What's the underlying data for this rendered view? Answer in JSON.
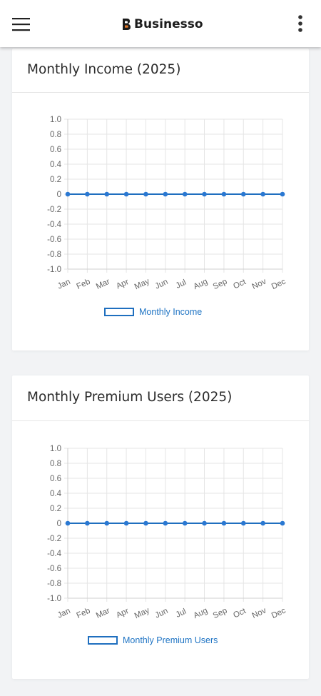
{
  "header": {
    "brand_letter": "B",
    "brand_name": "Businesso"
  },
  "icons": {
    "menu": "hamburger-menu-icon",
    "more": "vertical-dots-icon",
    "logo": "businesso-logo-icon"
  },
  "colors": {
    "line": "#1f6fbf",
    "point": "#2a78d2",
    "legend_text": "#1f74c4",
    "grid": "#e5e5e5"
  },
  "cards": [
    {
      "title": "Monthly Income (2025)",
      "legend": "Monthly Income"
    },
    {
      "title": "Monthly Premium Users (2025)",
      "legend": "Monthly Premium Users"
    }
  ],
  "chart_data": [
    {
      "type": "line",
      "title": "Monthly Income (2025)",
      "categories": [
        "Jan",
        "Feb",
        "Mar",
        "Apr",
        "May",
        "Jun",
        "Jul",
        "Aug",
        "Sep",
        "Oct",
        "Nov",
        "Dec"
      ],
      "series": [
        {
          "name": "Monthly Income",
          "values": [
            0,
            0,
            0,
            0,
            0,
            0,
            0,
            0,
            0,
            0,
            0,
            0
          ]
        }
      ],
      "ylim": [
        -1.0,
        1.0
      ],
      "yticks": [
        "1.0",
        "0.8",
        "0.6",
        "0.4",
        "0.2",
        "0",
        "-0.2",
        "-0.4",
        "-0.6",
        "-0.8",
        "-1.0"
      ],
      "grid": true,
      "legend_position": "bottom"
    },
    {
      "type": "line",
      "title": "Monthly Premium Users (2025)",
      "categories": [
        "Jan",
        "Feb",
        "Mar",
        "Apr",
        "May",
        "Jun",
        "Jul",
        "Aug",
        "Sep",
        "Oct",
        "Nov",
        "Dec"
      ],
      "series": [
        {
          "name": "Monthly Premium Users",
          "values": [
            0,
            0,
            0,
            0,
            0,
            0,
            0,
            0,
            0,
            0,
            0,
            0
          ]
        }
      ],
      "ylim": [
        -1.0,
        1.0
      ],
      "yticks": [
        "1.0",
        "0.8",
        "0.6",
        "0.4",
        "0.2",
        "0",
        "-0.2",
        "-0.4",
        "-0.6",
        "-0.8",
        "-1.0"
      ],
      "grid": true,
      "legend_position": "bottom"
    }
  ]
}
